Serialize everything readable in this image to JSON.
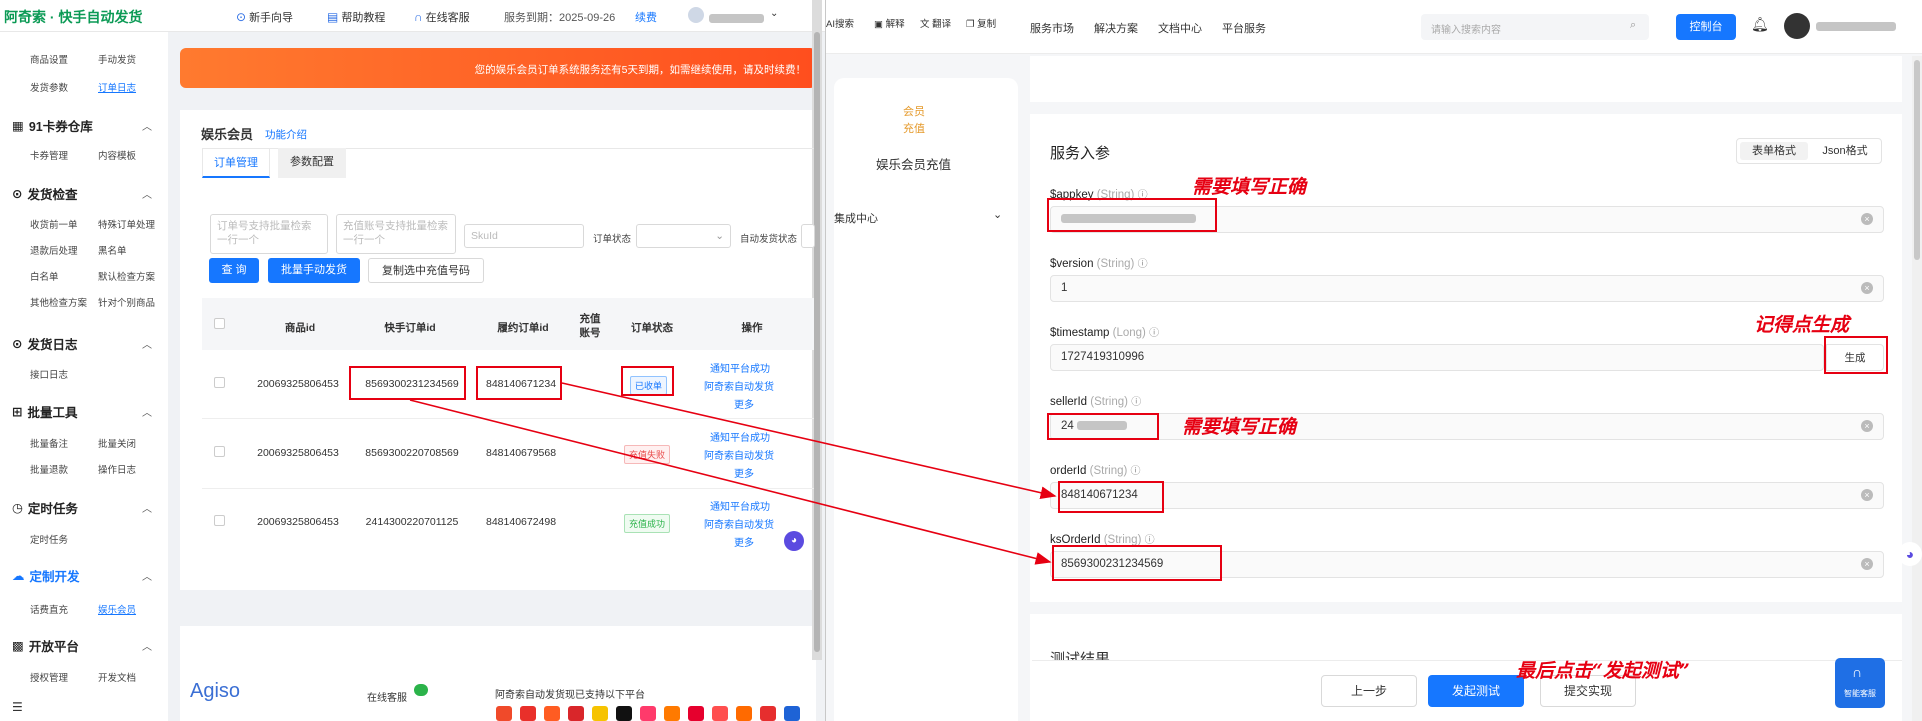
{
  "left_app": {
    "brand": "阿奇索 · 快手自动发货",
    "topnav": {
      "guide": "新手向导",
      "help": "帮助教程",
      "service": "在线客服",
      "expiry": "服务到期：2025-09-26",
      "renew": "续费"
    },
    "sidebar": {
      "top_items": [
        "商品设置",
        "手动发货",
        "发货参数",
        "订单日志"
      ],
      "groups": [
        {
          "title": "91卡券仓库",
          "items": [
            "卡券管理",
            "内容模板"
          ]
        },
        {
          "title": "发货检查",
          "items": [
            "收货前一单",
            "特殊订单处理",
            "退款后处理",
            "黑名单",
            "白名单",
            "默认检查方案",
            "其他检查方案",
            "针对个别商品"
          ]
        },
        {
          "title": "发货日志",
          "items": [
            "接口日志"
          ]
        },
        {
          "title": "批量工具",
          "items": [
            "批量备注",
            "批量关闭",
            "批量退款",
            "操作日志"
          ]
        },
        {
          "title": "定时任务",
          "items": [
            "定时任务"
          ]
        },
        {
          "title": "定制开发",
          "items": [
            "话费直充",
            "娱乐会员"
          ]
        },
        {
          "title": "开放平台",
          "items": [
            "授权管理",
            "开发文档"
          ]
        }
      ]
    },
    "banner": "您的娱乐会员订单系统服务还有5天到期，如需继续使用，请及时续费！",
    "page_title": "娱乐会员",
    "page_link": "功能介绍",
    "tabs": [
      "订单管理",
      "参数配置"
    ],
    "filters": {
      "order_placeholder": "订单号支持批量检索一行一个",
      "recharge_placeholder": "充值账号支持批量检索一行一个",
      "skuid_placeholder": "SkuId",
      "order_status_label": "订单状态",
      "auto_ship_label": "自动发货状态"
    },
    "buttons": {
      "query": "查 询",
      "batch": "批量手动发货",
      "copy": "复制选中充值号码"
    },
    "table": {
      "headers": [
        "商品id",
        "快手订单id",
        "履约订单id",
        "充值账号",
        "订单状态",
        "操作"
      ],
      "rows": [
        {
          "product_id": "20069325806453",
          "ks_order_id": "8569300231234569",
          "fulfil_id": "848140671234",
          "status": "已收单",
          "status_color": "#1677ff"
        },
        {
          "product_id": "20069325806453",
          "ks_order_id": "8569300220708569",
          "fulfil_id": "848140679568",
          "status": "充值失败",
          "status_color": "#e84a4a"
        },
        {
          "product_id": "20069325806453",
          "ks_order_id": "2414300220701125",
          "fulfil_id": "848140672498",
          "status": "充值成功",
          "status_color": "#2bb34a"
        }
      ],
      "actions": [
        "通知平台成功",
        "阿奇索自动发货",
        "更多"
      ]
    },
    "footer": {
      "logo": "Agiso",
      "service": "在线客服",
      "supports": "阿奇索自动发货现已支持以下平台"
    }
  },
  "right_app": {
    "topbar": {
      "tools": [
        "AI搜索",
        "解释",
        "翻译",
        "复制"
      ],
      "nav": [
        "服务市场",
        "解决方案",
        "文档中心",
        "平台服务"
      ],
      "search_placeholder": "请输入搜索内容",
      "console": "控制台"
    },
    "left_panel": {
      "tag": "会员充值",
      "name": "娱乐会员充值",
      "integration": "集成中心"
    },
    "section_title": "服务入参",
    "format_tabs": [
      "表单格式",
      "Json格式"
    ],
    "fields": [
      {
        "name": "$appkey",
        "type": "(String)",
        "value": ""
      },
      {
        "name": "$version",
        "type": "(String)",
        "value": "1"
      },
      {
        "name": "$timestamp",
        "type": "(Long)",
        "value": "1727419310996"
      },
      {
        "name": "sellerId",
        "type": "(String)",
        "value": "24"
      },
      {
        "name": "orderId",
        "type": "(String)",
        "value": "848140671234"
      },
      {
        "name": "ksOrderId",
        "type": "(String)",
        "value": "8569300231234569"
      }
    ],
    "generate_button": "生成",
    "test_result_title": "测试结果",
    "buttons": {
      "prev": "上一步",
      "test": "发起测试",
      "submit": "提交实现"
    },
    "help_button": "智能客服"
  },
  "annotations": {
    "fill_correct": "需要填写正确",
    "remember_generate": "记得点生成",
    "finally_click": "最后点击“发起测试”"
  },
  "colors": {
    "accent_blue": "#1677ff",
    "annotation_red": "#e60012",
    "banner_orange": "#ff6a2a",
    "brand_green": "#0b9a55"
  }
}
